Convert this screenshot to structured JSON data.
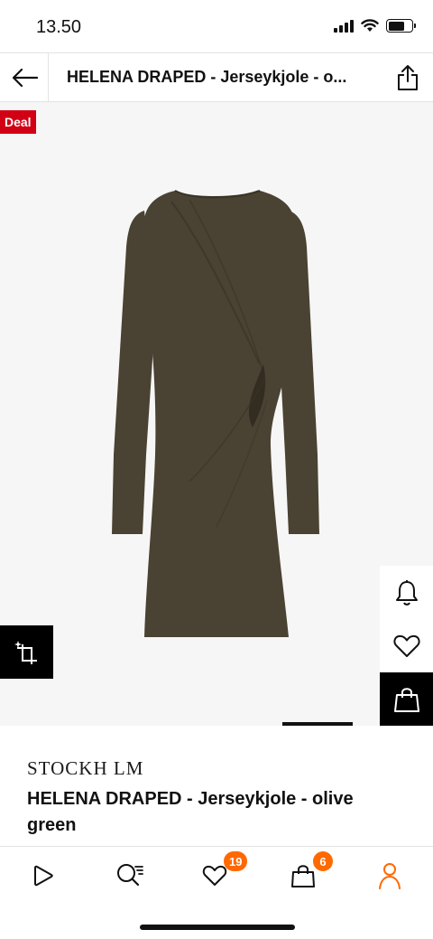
{
  "status_bar": {
    "time": "13.50"
  },
  "header": {
    "title": "HELENA DRAPED - Jerseykjole - o...",
    "back_icon": "arrow-left-icon",
    "share_icon": "share-icon"
  },
  "gallery": {
    "badge": "Deal",
    "badge_color": "#d20014",
    "dress_color": "#4a4232",
    "compare_icon": "crop-compare-icon",
    "side_actions": [
      "bell-icon",
      "heart-icon",
      "shopping-bag-icon"
    ]
  },
  "product": {
    "brand": "STOCKH LM",
    "name": "HELENA DRAPED - Jerseykjole - olive green"
  },
  "bottom_nav": {
    "accent": "#ff6900",
    "items": [
      {
        "icon": "play-icon"
      },
      {
        "icon": "search-list-icon"
      },
      {
        "icon": "heart-icon",
        "badge": "19"
      },
      {
        "icon": "bag-icon",
        "badge": "6"
      },
      {
        "icon": "profile-icon",
        "active": true
      }
    ]
  }
}
